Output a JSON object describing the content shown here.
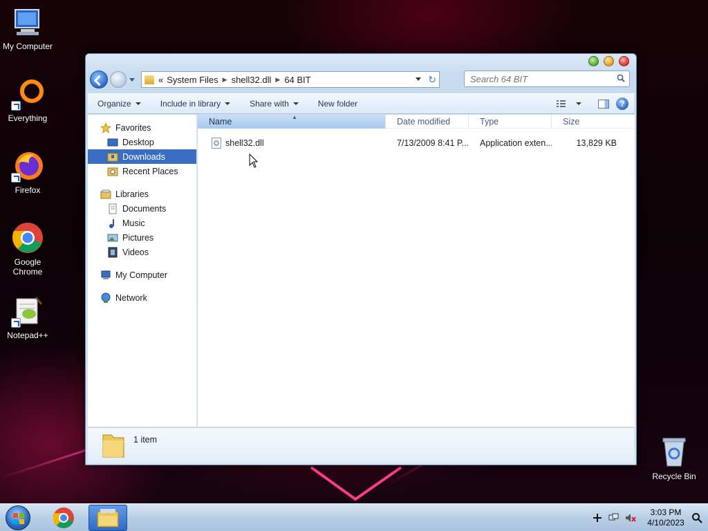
{
  "desktop": {
    "icons": [
      {
        "label": "My Computer"
      },
      {
        "label": "Everything"
      },
      {
        "label": "Firefox"
      },
      {
        "label": "Google Chrome"
      },
      {
        "label": "Notepad++"
      },
      {
        "label": "Recycle Bin"
      }
    ]
  },
  "explorer": {
    "address": {
      "lead": "«",
      "segments": [
        "System Files",
        "shell32.dll",
        "64 BIT"
      ]
    },
    "search": {
      "placeholder": "Search 64 BIT"
    },
    "toolbar": {
      "organize": "Organize",
      "include_in_library": "Include in library",
      "share_with": "Share with",
      "new_folder": "New folder",
      "help": "?"
    },
    "nav": {
      "favorites": "Favorites",
      "desktop": "Desktop",
      "downloads": "Downloads",
      "recent_places": "Recent Places",
      "libraries": "Libraries",
      "documents": "Documents",
      "music": "Music",
      "pictures": "Pictures",
      "videos": "Videos",
      "my_computer": "My Computer",
      "network": "Network"
    },
    "columns": {
      "name": "Name",
      "date_modified": "Date modified",
      "type": "Type",
      "size": "Size"
    },
    "files": [
      {
        "name": "shell32.dll",
        "date_modified": "7/13/2009 8:41 P...",
        "type": "Application exten...",
        "size": "13,829 KB"
      }
    ],
    "status": {
      "item_count": "1 item"
    }
  },
  "taskbar": {
    "clock_time": "3:03 PM",
    "clock_date": "4/10/2023"
  }
}
